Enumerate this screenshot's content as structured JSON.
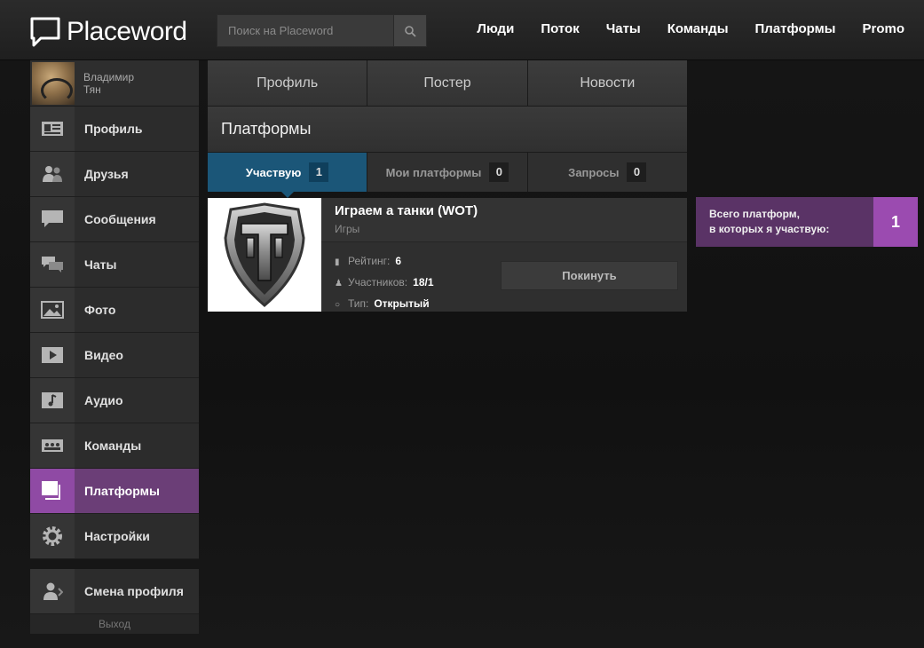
{
  "header": {
    "logo_text": "Placeword",
    "search_placeholder": "Поиск на Placeword",
    "nav": [
      "Люди",
      "Поток",
      "Чаты",
      "Команды",
      "Платформы",
      "Promo"
    ]
  },
  "sidebar": {
    "user_first": "Владимир",
    "user_last": "Тян",
    "items": [
      {
        "label": "Профиль",
        "icon": "profile-card-icon"
      },
      {
        "label": "Друзья",
        "icon": "friends-icon"
      },
      {
        "label": "Сообщения",
        "icon": "message-bubble-icon"
      },
      {
        "label": "Чаты",
        "icon": "chat-bubbles-icon"
      },
      {
        "label": "Фото",
        "icon": "photo-icon"
      },
      {
        "label": "Видео",
        "icon": "video-play-icon"
      },
      {
        "label": "Аудио",
        "icon": "music-note-icon"
      },
      {
        "label": "Команды",
        "icon": "team-icon"
      },
      {
        "label": "Платформы",
        "icon": "platforms-icon",
        "active": true
      },
      {
        "label": "Настройки",
        "icon": "gear-icon"
      }
    ],
    "switch_label": "Смена профиля",
    "exit_label": "Выход"
  },
  "main": {
    "tabs": [
      "Профиль",
      "Постер",
      "Новости"
    ],
    "section_title": "Платформы",
    "subtabs": [
      {
        "label": "Участвую",
        "count": "1",
        "active": true
      },
      {
        "label": "Мои платформы",
        "count": "0"
      },
      {
        "label": "Запросы",
        "count": "0"
      }
    ],
    "card": {
      "title": "Играем а танки (WOT)",
      "category": "Игры",
      "rating_label": "Рейтинг:",
      "rating_value": "6",
      "members_label": "Участников:",
      "members_value": "18/1",
      "type_label": "Тип:",
      "type_value": "Открытый",
      "leave_label": "Покинуть"
    }
  },
  "summary": {
    "line1": "Всего платформ,",
    "line2": "в которых я участвую:",
    "count": "1"
  },
  "colors": {
    "accent_purple": "#9b4bb0",
    "accent_blue": "#1b5678"
  }
}
